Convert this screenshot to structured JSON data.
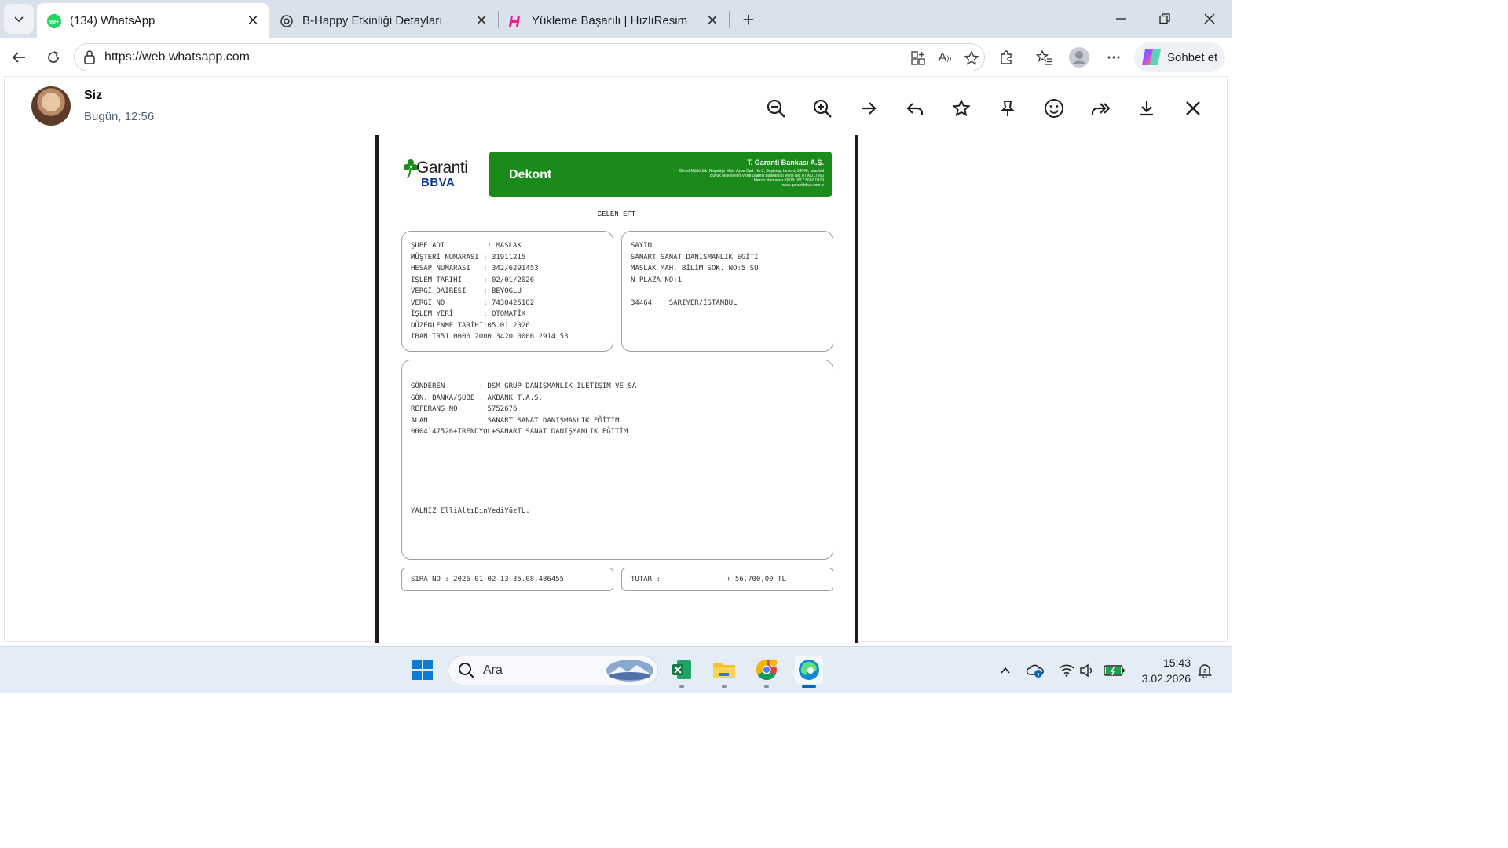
{
  "browser": {
    "tabs": [
      {
        "label": "(134) WhatsApp",
        "badge": "99+"
      },
      {
        "label": "B-Happy Etkinliği Detayları"
      },
      {
        "label": "Yükleme Başarılı | HızlıResim"
      }
    ],
    "url": "https://web.whatsapp.com",
    "copilot_label": "Sohbet et"
  },
  "viewer": {
    "sender_name": "Siz",
    "sender_time": "Bugün, 12:56"
  },
  "receipt": {
    "brand_name": "Garanti",
    "brand_sub": "BBVA",
    "title": "Dekont",
    "bank_name": "T. Garanti Bankası A.Ş.",
    "bank_lines": [
      "Genel Müdürlük: Nispetiye Mah. Aytar Cad. No:2, Beşiktaş, Levent, 34340, İstanbul",
      "Büyük Mükellefler Vergi Dairesi Başkanlığı Vergi No: 8790017566",
      "Mersis Numarası: 0879 0017 5660 0379",
      "www.garantibbva.com.tr"
    ],
    "type": "GELEN EFT",
    "account_lines": [
      "ŞUBE ADI          : MASLAK",
      "MÜŞTERİ NUMARASI : 31911215",
      "HESAP NUMARASI   : 342/6291453",
      "İŞLEM TARİHİ     : 02/01/2026",
      "VERGİ DAİRESİ    : BEYOGLU",
      "VERGİ NO         : 7430425102",
      "İŞLEM YERİ       : OTOMATİK",
      "DÜZENLENME TARİHİ:05.01.2026",
      "IBAN:TR51 0006 2000 3420 0006 2914 53"
    ],
    "recipient_lines": [
      "SAYIN",
      "SANART SANAT DANISMANLIK EGİTİ",
      "MASLAK MAH. BİLİM SOK. NO:5 SU",
      "N PLAZA NO:1",
      "",
      "34464    SARIYER/İSTANBUL"
    ],
    "detail_lines": [
      "GÖNDEREN        : DSM GRUP DANIŞMANLIK İLETİŞİM VE SA",
      "GÖN. BANKA/ŞUBE : AKBANK T.A.S.",
      "REFERANS NO     : 5752676",
      "ALAN            : SANART SANAT DANIŞMANLIK EĞİTİM",
      "0004147526+TRENDYOL+SANART SANAT DANIŞMANLIK EĞİTİM"
    ],
    "amount_words": "YALNIZ ElliAltıBinYediYüzTL.",
    "sira_no": "SIRA NO : 2026-01-02-13.35.08.486455",
    "tutar_label": "TUTAR :",
    "tutar_value": "+ 56.700,00 TL"
  },
  "taskbar": {
    "search_placeholder": "Ara",
    "time": "15:43",
    "date": "3.02.2026"
  },
  "colors": {
    "dekont_green": "#1a8a1a",
    "whatsapp_green": "#25d366",
    "edge_blue": "#0067c0"
  }
}
